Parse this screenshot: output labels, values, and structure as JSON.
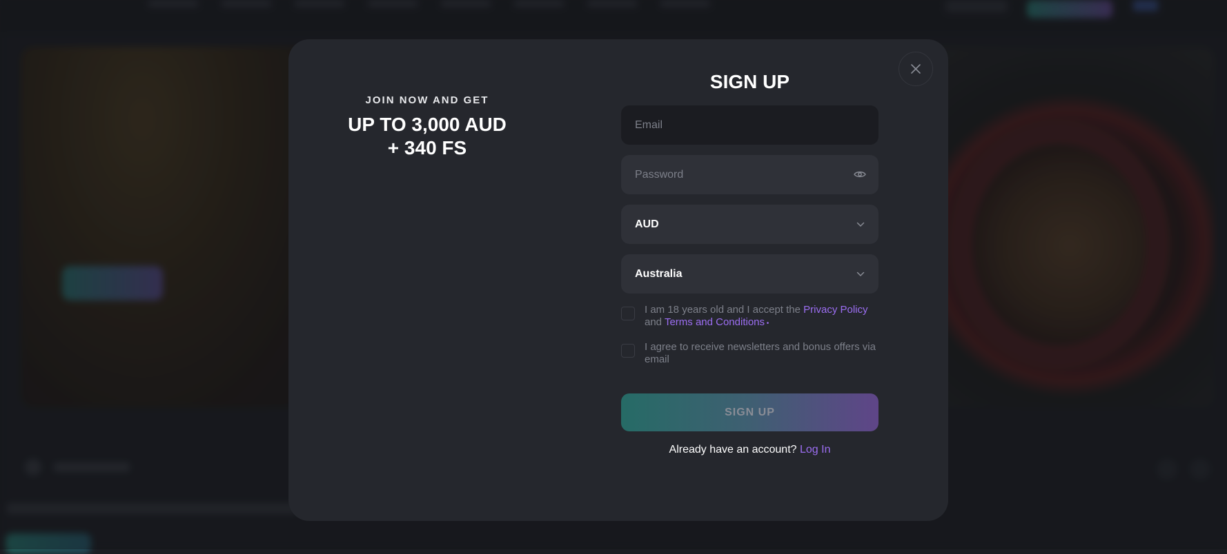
{
  "modal": {
    "promo": {
      "kicker": "JOIN NOW AND GET",
      "headline_line1": "UP TO 3,000 AUD",
      "headline_line2": "+ 340 FS"
    },
    "title": "SIGN UP",
    "email": {
      "placeholder": "Email",
      "value": ""
    },
    "password": {
      "placeholder": "Password",
      "value": "",
      "icon": "eye-icon"
    },
    "currency": {
      "value": "AUD"
    },
    "country": {
      "value": "Australia"
    },
    "terms": {
      "prefix": "I am 18 years old and I accept the ",
      "privacy_link": "Privacy Policy",
      "middle": " and ",
      "terms_link": "Terms and Conditions",
      "required_mark": " •"
    },
    "newsletter": {
      "text": "I agree to receive newsletters and bonus offers via email"
    },
    "submit_label": "SIGN UP",
    "login": {
      "prompt": "Already have an account? ",
      "link": "Log In"
    }
  },
  "colors": {
    "accent": "#9c6ef2",
    "modal_bg": "#25272d",
    "field_bg": "#2f3138",
    "page_bg": "#1b1c21"
  }
}
